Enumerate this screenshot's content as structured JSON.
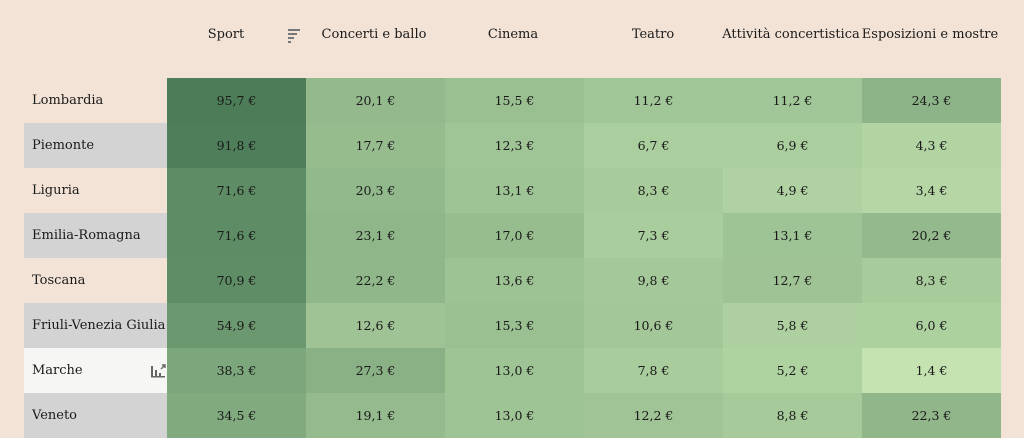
{
  "chart_data": {
    "type": "heatmap",
    "columns": [
      "Sport",
      "Concerti e ballo",
      "Cinema",
      "Teatro",
      "Attività concertistica",
      "Esposizioni e mostre"
    ],
    "rows": [
      "Lombardia",
      "Piemonte",
      "Liguria",
      "Emilia-Romagna",
      "Toscana",
      "Friuli-Venezia Giulia",
      "Marche",
      "Veneto"
    ],
    "values": [
      [
        95.7,
        20.1,
        15.5,
        11.2,
        11.2,
        24.3
      ],
      [
        91.8,
        17.7,
        12.3,
        6.7,
        6.9,
        4.3
      ],
      [
        71.6,
        20.3,
        13.1,
        8.3,
        4.9,
        3.4
      ],
      [
        71.6,
        23.1,
        17.0,
        7.3,
        13.1,
        20.2
      ],
      [
        70.9,
        22.2,
        13.6,
        9.8,
        12.7,
        8.3
      ],
      [
        54.9,
        12.6,
        15.3,
        10.6,
        5.8,
        6.0
      ],
      [
        38.3,
        27.3,
        13.0,
        7.8,
        5.2,
        1.4
      ],
      [
        34.5,
        19.1,
        13.0,
        12.2,
        8.8,
        22.3
      ]
    ],
    "labels": [
      [
        "95,7 €",
        "20,1 €",
        "15,5 €",
        "11,2 €",
        "11,2 €",
        "24,3 €"
      ],
      [
        "91,8 €",
        "17,7 €",
        "12,3 €",
        "6,7 €",
        "6,9 €",
        "4,3 €"
      ],
      [
        "71,6 €",
        "20,3 €",
        "13,1 €",
        "8,3 €",
        "4,9 €",
        "3,4 €"
      ],
      [
        "71,6 €",
        "23,1 €",
        "17,0 €",
        "7,3 €",
        "13,1 €",
        "20,2 €"
      ],
      [
        "70,9 €",
        "22,2 €",
        "13,6 €",
        "9,8 €",
        "12,7 €",
        "8,3 €"
      ],
      [
        "54,9 €",
        "12,6 €",
        "15,3 €",
        "10,6 €",
        "5,8 €",
        "6,0 €"
      ],
      [
        "38,3 €",
        "27,3 €",
        "13,0 €",
        "7,8 €",
        "5,2 €",
        "1,4 €"
      ],
      [
        "34,5 €",
        "19,1 €",
        "13,0 €",
        "12,2 €",
        "8,8 €",
        "22,3 €"
      ]
    ],
    "sorted_by": "Sport",
    "highlighted_row": "Marche",
    "color_scale": {
      "low": "#c4e3b0",
      "high": "#4c7d58"
    }
  },
  "colors": {
    "background": "#f3e3d6",
    "row_label_alt": "#d3d3d3",
    "row_label_highlight": "#f6f6f4"
  },
  "icons": {
    "sort": "sort-descending-icon",
    "row_chart": "bar-chart-icon"
  }
}
